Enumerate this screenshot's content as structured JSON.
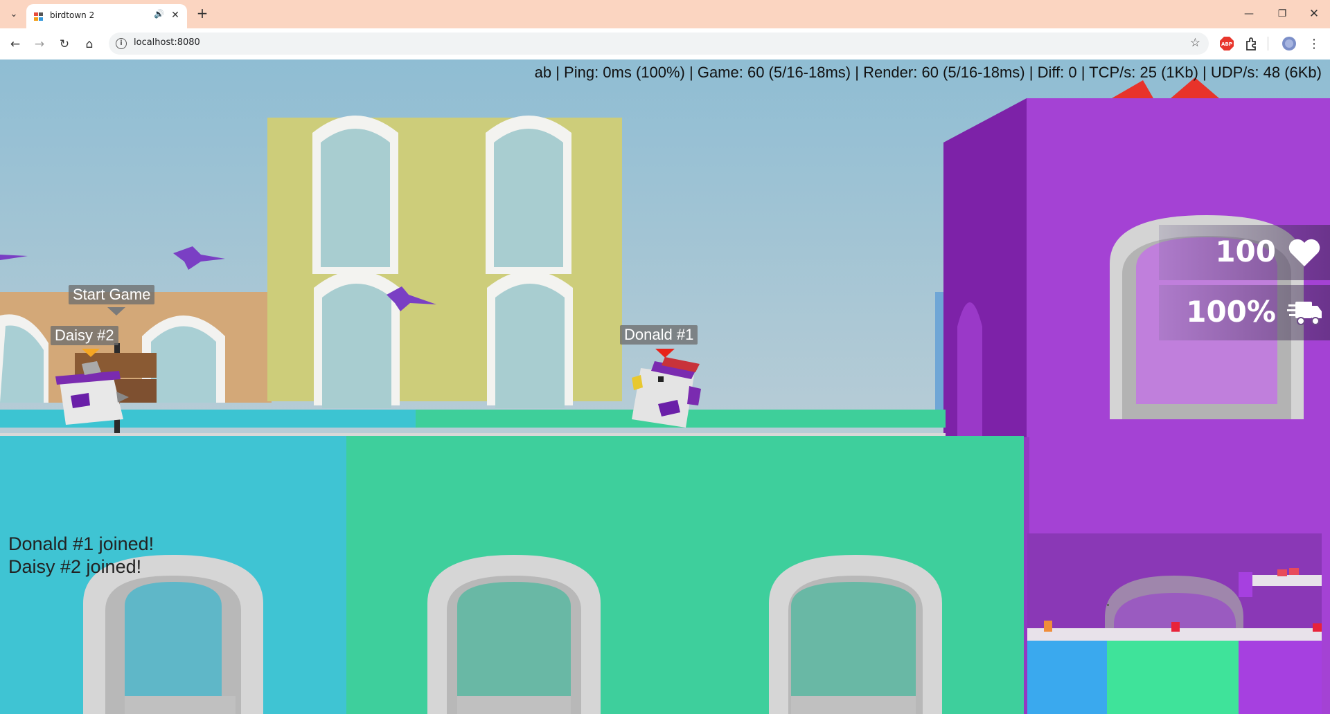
{
  "browser": {
    "tab_title": "birdtown 2",
    "url": "localhost:8080",
    "tab_list_icon": "chevron-down-icon",
    "audio_icon": "speaker-icon",
    "close_icon": "close-icon",
    "new_tab_label": "+",
    "window_controls": [
      "minimize-icon",
      "restore-icon",
      "close-icon"
    ],
    "extensions": [
      "adblock-icon",
      "extensions-puzzle-icon",
      "profile-avatar-icon",
      "menu-dots-icon"
    ]
  },
  "game": {
    "stats": "ab | Ping: 0ms (100%) | Game: 60 (5/16-18ms) | Render: 60 (5/16-18ms) | Diff: 0 | TCP/s: 25 (1Kb) | UDP/s: 48 (6Kb)",
    "sign_label": "Start Game",
    "players": [
      {
        "name": "Daisy #2",
        "marker_color": "#f5a623"
      },
      {
        "name": "Donald #1",
        "marker_color": "#e8231a"
      }
    ],
    "hud": {
      "health": "100",
      "health_icon": "heart-icon",
      "speed": "100%",
      "speed_icon": "truck-fast-icon"
    },
    "chat": [
      "Donald #1 joined!",
      "Daisy #2 joined!"
    ],
    "colors": {
      "sky_top": "#8fbdd3",
      "sky_bottom": "#c9d3d6",
      "cyan_block": "#3fc4d3",
      "green_block": "#3ecf9c",
      "purple_block": "#a442d4",
      "yellow_building": "#cdcd7a",
      "tan_building": "#d3a878"
    }
  }
}
